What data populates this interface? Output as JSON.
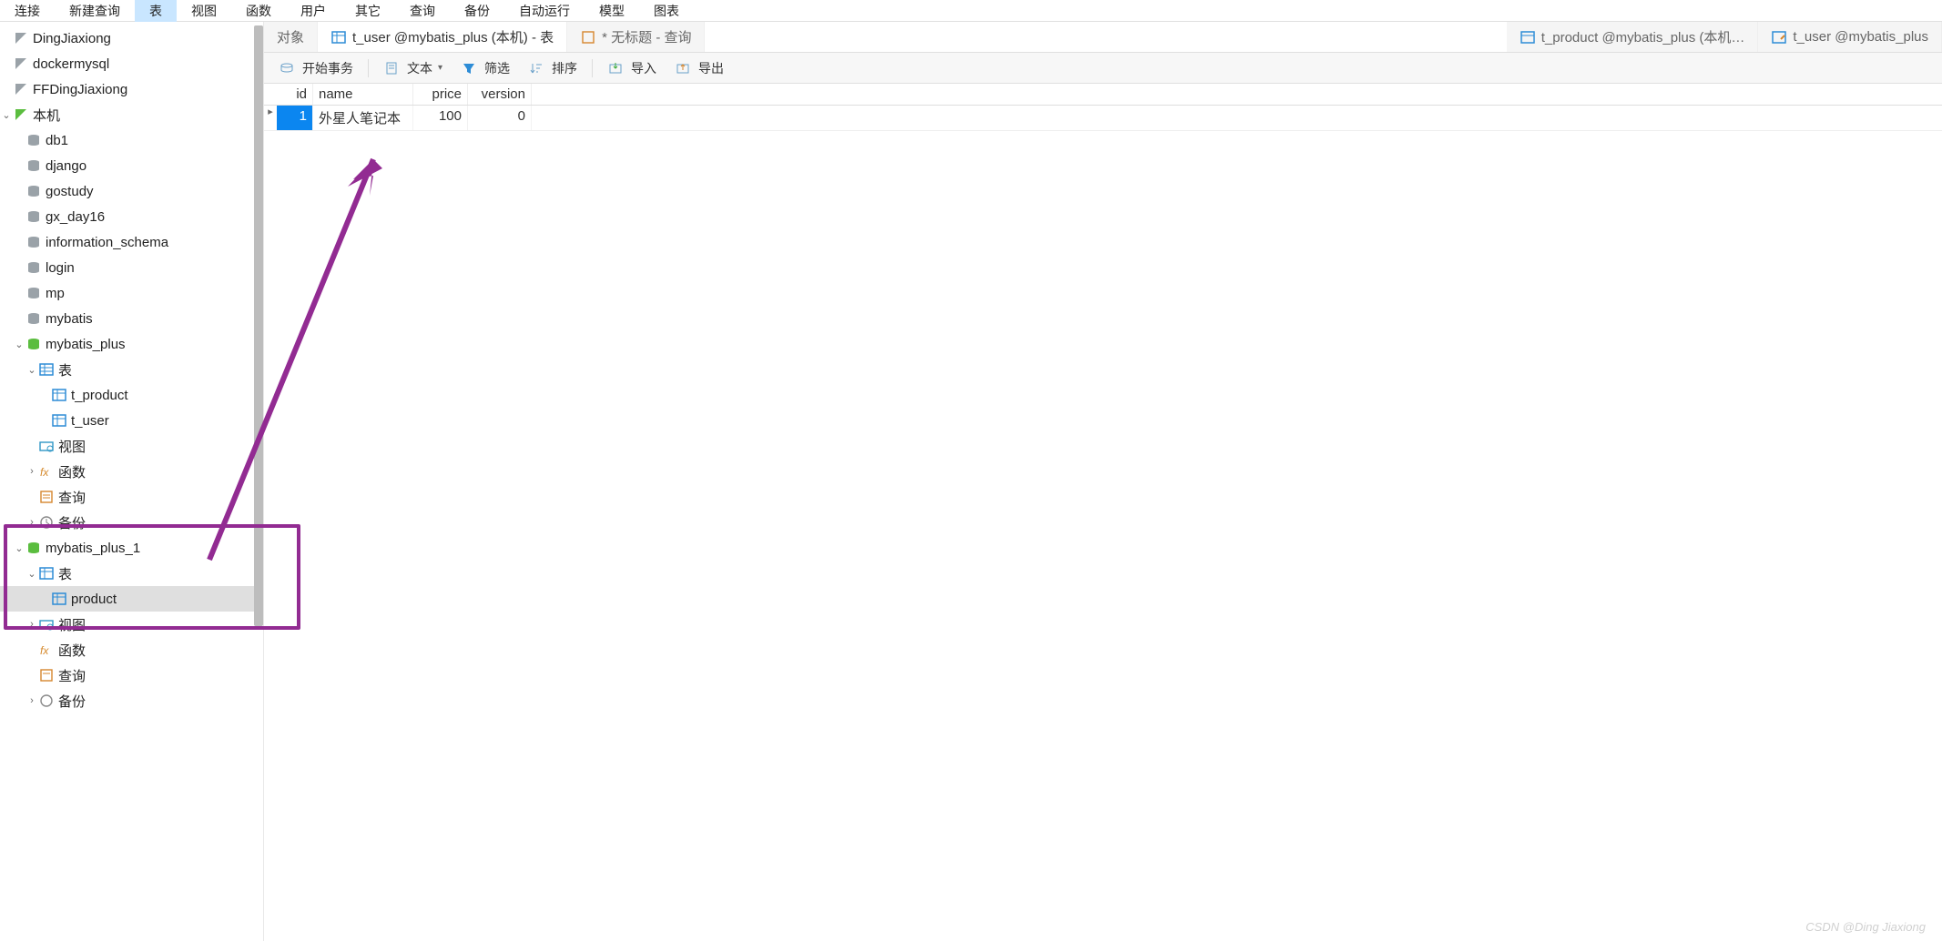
{
  "menu": [
    "连接",
    "新建查询",
    "表",
    "视图",
    "函数",
    "用户",
    "其它",
    "查询",
    "备份",
    "自动运行",
    "模型",
    "图表"
  ],
  "menu_active_index": 2,
  "sidebar": {
    "connections": [
      {
        "label": "DingJiaxiong"
      },
      {
        "label": "dockermysql"
      },
      {
        "label": "FFDingJiaxiong"
      }
    ],
    "active_connection": "本机",
    "databases": [
      "db1",
      "django",
      "gostudy",
      "gx_day16",
      "information_schema",
      "login",
      "mp",
      "mybatis"
    ],
    "db_expanded_1": {
      "name": "mybatis_plus",
      "tables_label": "表",
      "tables": [
        "t_product",
        "t_user"
      ],
      "views": "视图",
      "functions": "函数",
      "queries": "查询",
      "backups": "备份"
    },
    "db_expanded_2": {
      "name": "mybatis_plus_1",
      "tables_label": "表",
      "tables": [
        "product"
      ],
      "views": "视图",
      "functions": "函数",
      "queries": "查询",
      "backups": "备份"
    }
  },
  "tabs": {
    "object": "对象",
    "t1": "t_user @mybatis_plus (本机) - 表",
    "t2": "* 无标题 - 查询",
    "t3": "t_product @mybatis_plus (本机…",
    "t4": "t_user @mybatis_plus"
  },
  "toolbar": {
    "begin_tx": "开始事务",
    "text": "文本",
    "filter": "筛选",
    "sort": "排序",
    "import": "导入",
    "export": "导出"
  },
  "grid": {
    "headers": [
      "id",
      "name",
      "price",
      "version"
    ],
    "rows": [
      {
        "id": "1",
        "name": "外星人笔记本",
        "price": "100",
        "version": "0"
      }
    ]
  },
  "watermark": "CSDN @Ding Jiaxiong",
  "colors": {
    "highlight": "#922b92",
    "selected_cell": "#0b86f0",
    "menu_active": "#c9e6ff"
  }
}
